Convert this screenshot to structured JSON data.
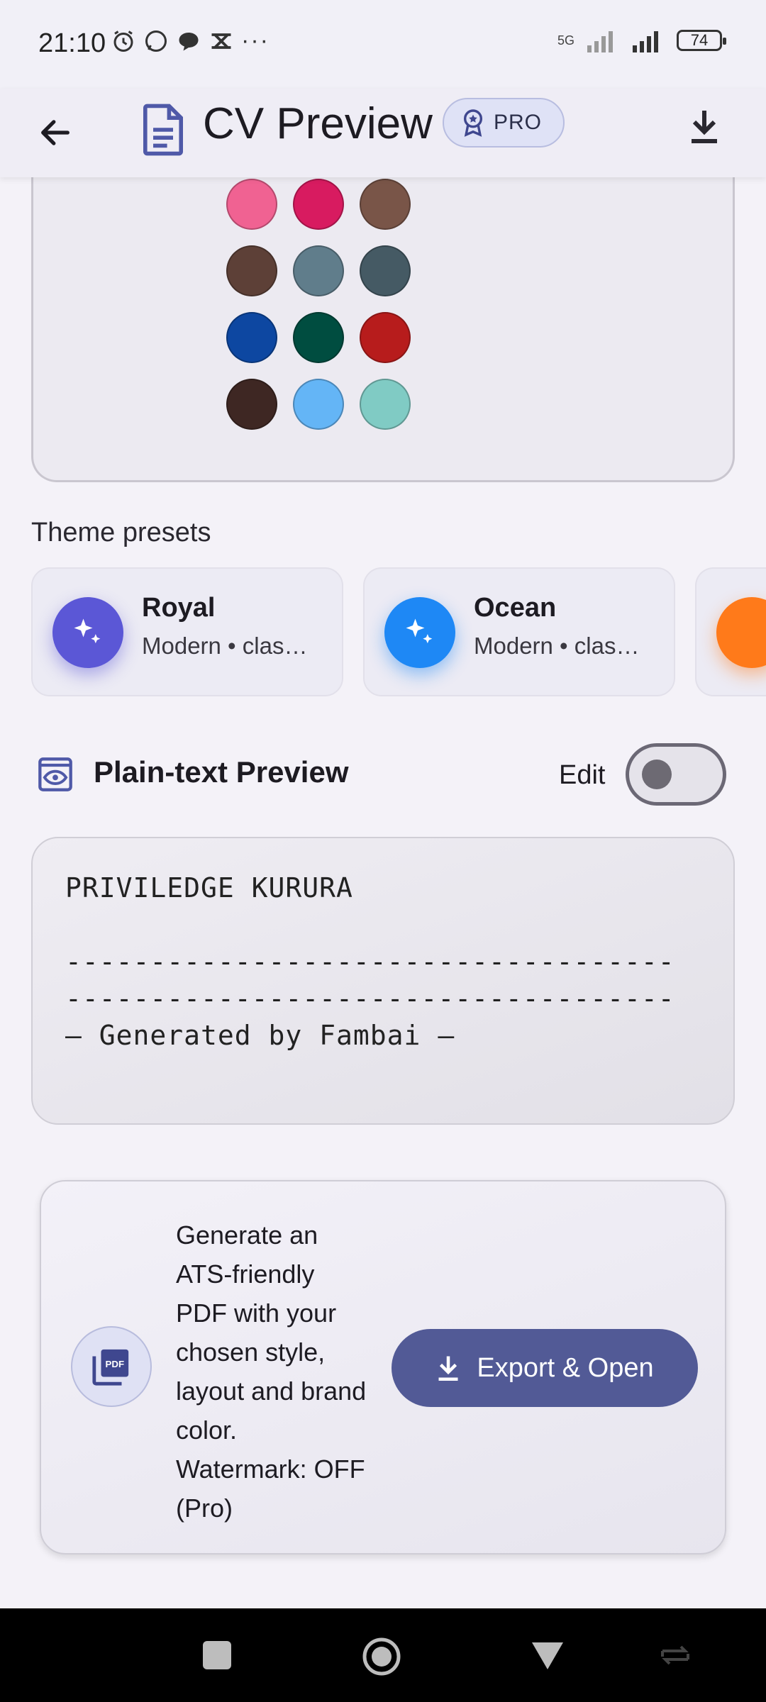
{
  "status_bar": {
    "time": "21:10",
    "network_label": "5G",
    "battery": "74"
  },
  "app_bar": {
    "title": "CV Preview",
    "pro_badge": "PRO",
    "icons": [
      "back-arrow-icon",
      "document-icon",
      "award-icon",
      "download-icon"
    ]
  },
  "colors": {
    "swatches": [
      [
        "#ff7a1a",
        "#f4433b",
        "#e94438"
      ],
      [
        "#f06292",
        "#d81b60",
        "#795548"
      ],
      [
        "#5d4037",
        "#607d8b",
        "#455a64"
      ],
      [
        "#0d47a1",
        "#004d40",
        "#b71c1c"
      ],
      [
        "#3e2723",
        "#64b5f6",
        "#80cbc4"
      ]
    ],
    "accent": "#525a96"
  },
  "theme_presets": {
    "title": "Theme presets",
    "items": [
      {
        "name": "Royal",
        "subtitle": "Modern • clas…",
        "color": "#5b57d6",
        "icon": "sparkles-icon"
      },
      {
        "name": "Ocean",
        "subtitle": "Modern • clas…",
        "color": "#1e88f5",
        "icon": "sparkles-icon"
      },
      {
        "name": "",
        "subtitle": "",
        "color": "#ff7a1a",
        "icon": "sparkles-icon"
      }
    ]
  },
  "plain_text": {
    "title": "Plain-text Preview",
    "edit_label": "Edit",
    "edit_enabled": false,
    "lines": [
      "PRIVILEDGE KURURA",
      "",
      "------------------------------------",
      "------------------------------------",
      "— Generated by Fambai —"
    ]
  },
  "export": {
    "description": "Generate an ATS-friendly PDF with your chosen style, layout and brand color. Watermark: OFF (Pro)",
    "button_label": "Export & Open",
    "pdf_label": "PDF"
  },
  "nav": {
    "icons": [
      "square-nav-icon",
      "home-circle-icon",
      "back-triangle-icon",
      "rotate-icon"
    ]
  }
}
